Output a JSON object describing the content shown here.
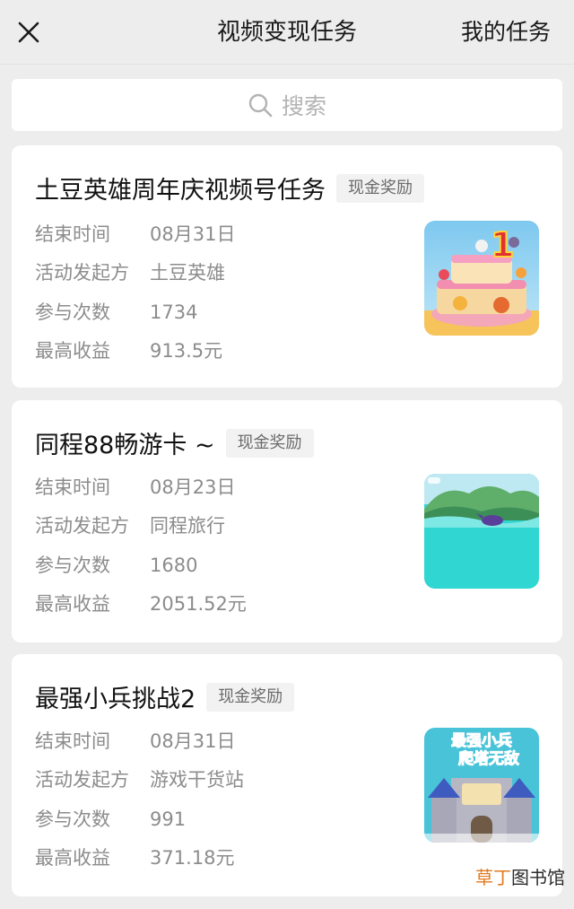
{
  "nav": {
    "title": "视频变现任务",
    "my_tasks": "我的任务"
  },
  "search": {
    "placeholder": "搜索"
  },
  "labels": {
    "end_time": "结束时间",
    "organizer": "活动发起方",
    "participants": "参与次数",
    "max_income": "最高收益"
  },
  "tasks": [
    {
      "name": "土豆英雄周年庆视频号任务",
      "tag": "现金奖励",
      "end_time": "08月31日",
      "organizer": "土豆英雄",
      "participants": "1734",
      "max_income": "913.5元",
      "thumb_text": "1"
    },
    {
      "name": "同程88畅游卡 ~",
      "tag": "现金奖励",
      "end_time": "08月23日",
      "organizer": "同程旅行",
      "participants": "1680",
      "max_income": "2051.52元"
    },
    {
      "name": "最强小兵挑战2",
      "tag": "现金奖励",
      "end_time": "08月31日",
      "organizer": "游戏干货站",
      "participants": "991",
      "max_income": "371.18元",
      "thumb_text_top": "最强小兵",
      "thumb_text_bottom": "爬塔无敌"
    }
  ],
  "watermark": {
    "part_a": "草丁",
    "part_b": "图书馆"
  },
  "colors": {
    "background": "#ededed",
    "card": "#ffffff",
    "tag_bg": "#f2f2f2",
    "label": "#8c8c8c"
  }
}
